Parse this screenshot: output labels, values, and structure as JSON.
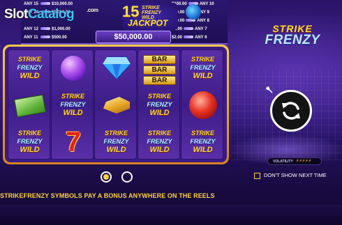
{
  "watermark": {
    "part1": "Slot",
    "part2": "Catalog",
    "domain": ".com"
  },
  "paytable": {
    "left_rows": [
      {
        "count": "ANY 15",
        "value": "$10,000.00"
      },
      {
        "count": "ANY 14",
        "value": "$5,000.00"
      },
      {
        "count": "ANY 12",
        "value": "$1,000.00"
      },
      {
        "count": "ANY 11",
        "value": "$500.00"
      }
    ],
    "right_rows": [
      {
        "value": "$100.00",
        "count": "ANY 10"
      },
      {
        "value": "$20.00",
        "count": "ANY 9"
      },
      {
        "value": "$10.00",
        "count": "ANY 8"
      },
      {
        "value": "$4.00",
        "count": "ANY 7"
      },
      {
        "value": "$2.00",
        "count": "ANY 6"
      }
    ],
    "jackpot_number": "15",
    "jackpot_word": "JACKPOT",
    "jackpot_mini": [
      "STRIKE",
      "FRENZY",
      "WILD"
    ],
    "jackpot_value": "$50,000.00"
  },
  "wild_text": {
    "line1": "STRIKE",
    "line2": "FRENZY",
    "line3": "WILD"
  },
  "bar_label": "BAR",
  "seven_label": "7",
  "reels": [
    [
      "wild",
      "cash",
      "wild"
    ],
    [
      "gem-purple",
      "wild",
      "seven"
    ],
    [
      "gem-blue",
      "gold",
      "wild"
    ],
    [
      "bars",
      "wild",
      "wild"
    ],
    [
      "wild",
      "gem-red",
      "wild"
    ]
  ],
  "logo": {
    "line1": "STRIKE",
    "line2": "FRENZY"
  },
  "volatility": {
    "label": "VOLATILITY",
    "bolts": "⚡⚡⚡⚡⚡"
  },
  "dont_show": {
    "label": "DON'T SHOW NEXT TIME"
  },
  "pagination": {
    "current": 1,
    "total": 2
  },
  "info_text": "STRIKEFRENZY SYMBOLS PAY A BONUS ANYWHERE ON THE REELS",
  "colors": {
    "accent_gold": "#ffd23a",
    "reel_purple": "#3c1d86",
    "frame_gold": "#ffc94a"
  }
}
